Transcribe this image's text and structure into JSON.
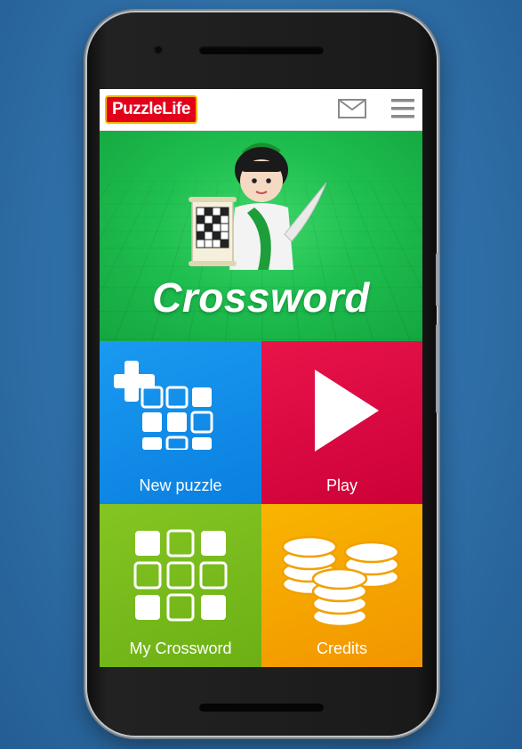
{
  "app": {
    "logo": "PuzzleLife",
    "hero_title": "Crossword"
  },
  "header": {
    "mail_icon": "mail-icon",
    "menu_icon": "hamburger-menu-icon"
  },
  "tiles": [
    {
      "label": "New puzzle",
      "icon": "new-puzzle-grid-plus-icon",
      "color": "#0a7fe0"
    },
    {
      "label": "Play",
      "icon": "play-icon",
      "color": "#cc0038"
    },
    {
      "label": "My Crossword",
      "icon": "grid-icon",
      "color": "#6cb015"
    },
    {
      "label": "Credits",
      "icon": "coins-icon",
      "color": "#f29500"
    }
  ],
  "colors": {
    "background": "#2f6fa8",
    "hero_green": "#1fbf50",
    "logo_red": "#e2001a"
  }
}
